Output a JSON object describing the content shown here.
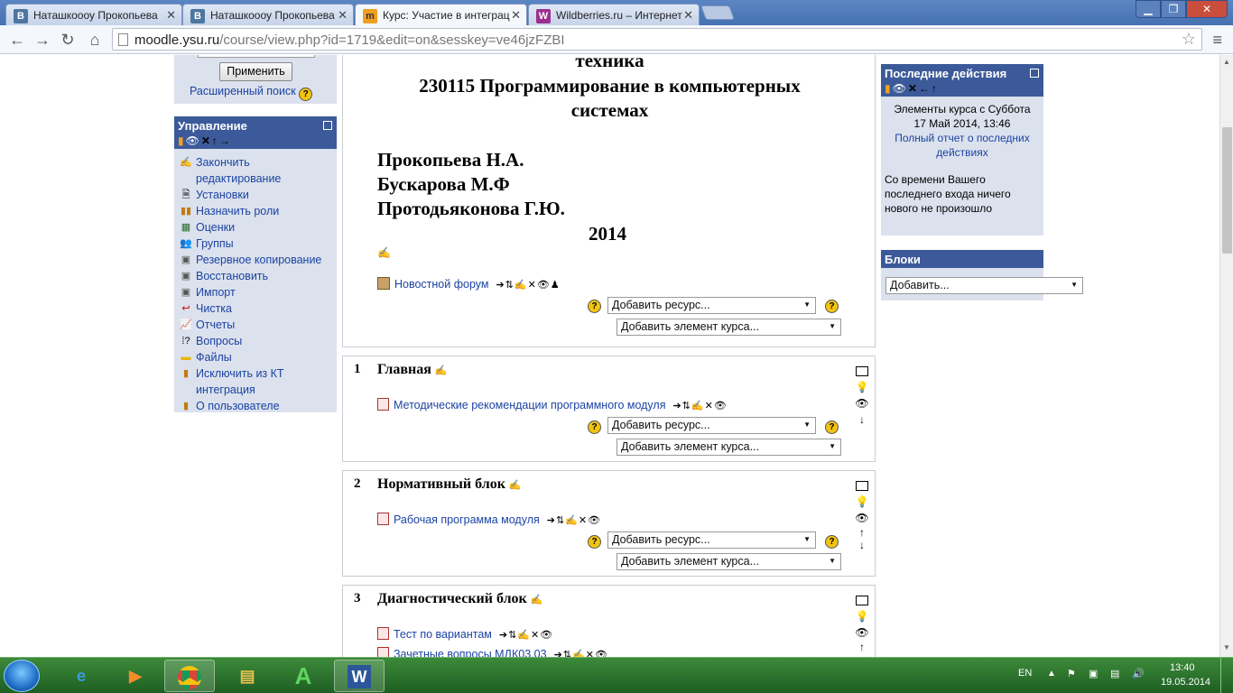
{
  "browser": {
    "tabs": [
      {
        "title": "Наташкоооу Прокопьева",
        "icon": "vk-icon"
      },
      {
        "title": "Наташкоооу Прокопьева",
        "icon": "vk-icon"
      },
      {
        "title": "Курс: Участие в интеграц",
        "icon": "moodle-icon",
        "active": true
      },
      {
        "title": "Wildberries.ru – Интернет",
        "icon": "wildberries-icon"
      }
    ],
    "url_host": "moodle.ysu.ru",
    "url_path": "/course/view.php?id=1719&edit=on&sesskey=ve46jzFZBI"
  },
  "search_block": {
    "apply_label": "Применить",
    "advanced_label": "Расширенный поиск"
  },
  "admin_block": {
    "title": "Управление",
    "items": [
      {
        "label": "Закончить редактирование",
        "icon": "edit-icon"
      },
      {
        "label": "Установки",
        "icon": "settings-icon"
      },
      {
        "label": "Назначить роли",
        "icon": "roles-icon"
      },
      {
        "label": "Оценки",
        "icon": "grades-icon"
      },
      {
        "label": "Группы",
        "icon": "groups-icon"
      },
      {
        "label": "Резервное копирование",
        "icon": "backup-icon"
      },
      {
        "label": "Восстановить",
        "icon": "restore-icon"
      },
      {
        "label": "Импорт",
        "icon": "import-icon"
      },
      {
        "label": "Чистка",
        "icon": "reset-icon"
      },
      {
        "label": "Отчеты",
        "icon": "reports-icon"
      },
      {
        "label": "Вопросы",
        "icon": "questions-icon"
      },
      {
        "label": "Файлы",
        "icon": "folder-icon"
      },
      {
        "label": "Исключить из КТ интеграция",
        "icon": "unenrol-icon"
      },
      {
        "label": "О пользователе",
        "icon": "user-icon"
      }
    ]
  },
  "course_header": {
    "line1": "техника",
    "line2": "230115 Программирование в компьютерных",
    "line3": "системах",
    "authors": [
      "Прокопьева Н.А.",
      "Бускарова М.Ф",
      "Протодьяконова Г.Ю."
    ],
    "year": "2014",
    "forum_link": "Новостной форум",
    "add_resource": "Добавить ресурс...",
    "add_activity": "Добавить элемент курса..."
  },
  "sections": [
    {
      "num": "1",
      "title": "Главная",
      "resources": [
        "Методические рекомендации программного модуля"
      ]
    },
    {
      "num": "2",
      "title": "Нормативный блок",
      "resources": [
        "Рабочая программа модуля"
      ]
    },
    {
      "num": "3",
      "title": "Диагностический блок",
      "resources": [
        "Тест по вариантам",
        "Зачетные вопросы МДК03.03"
      ]
    }
  ],
  "recent_block": {
    "title": "Последние действия",
    "since": "Элементы курса с Суббота 17 Май 2014, 13:46",
    "full_report": "Полный отчет о последних действиях",
    "nothing_new": "Со времени Вашего последнего входа ничего нового не произошло"
  },
  "blocks_block": {
    "title": "Блоки",
    "add_label": "Добавить..."
  },
  "taskbar": {
    "lang": "EN",
    "time": "13:40",
    "date": "19.05.2014"
  }
}
